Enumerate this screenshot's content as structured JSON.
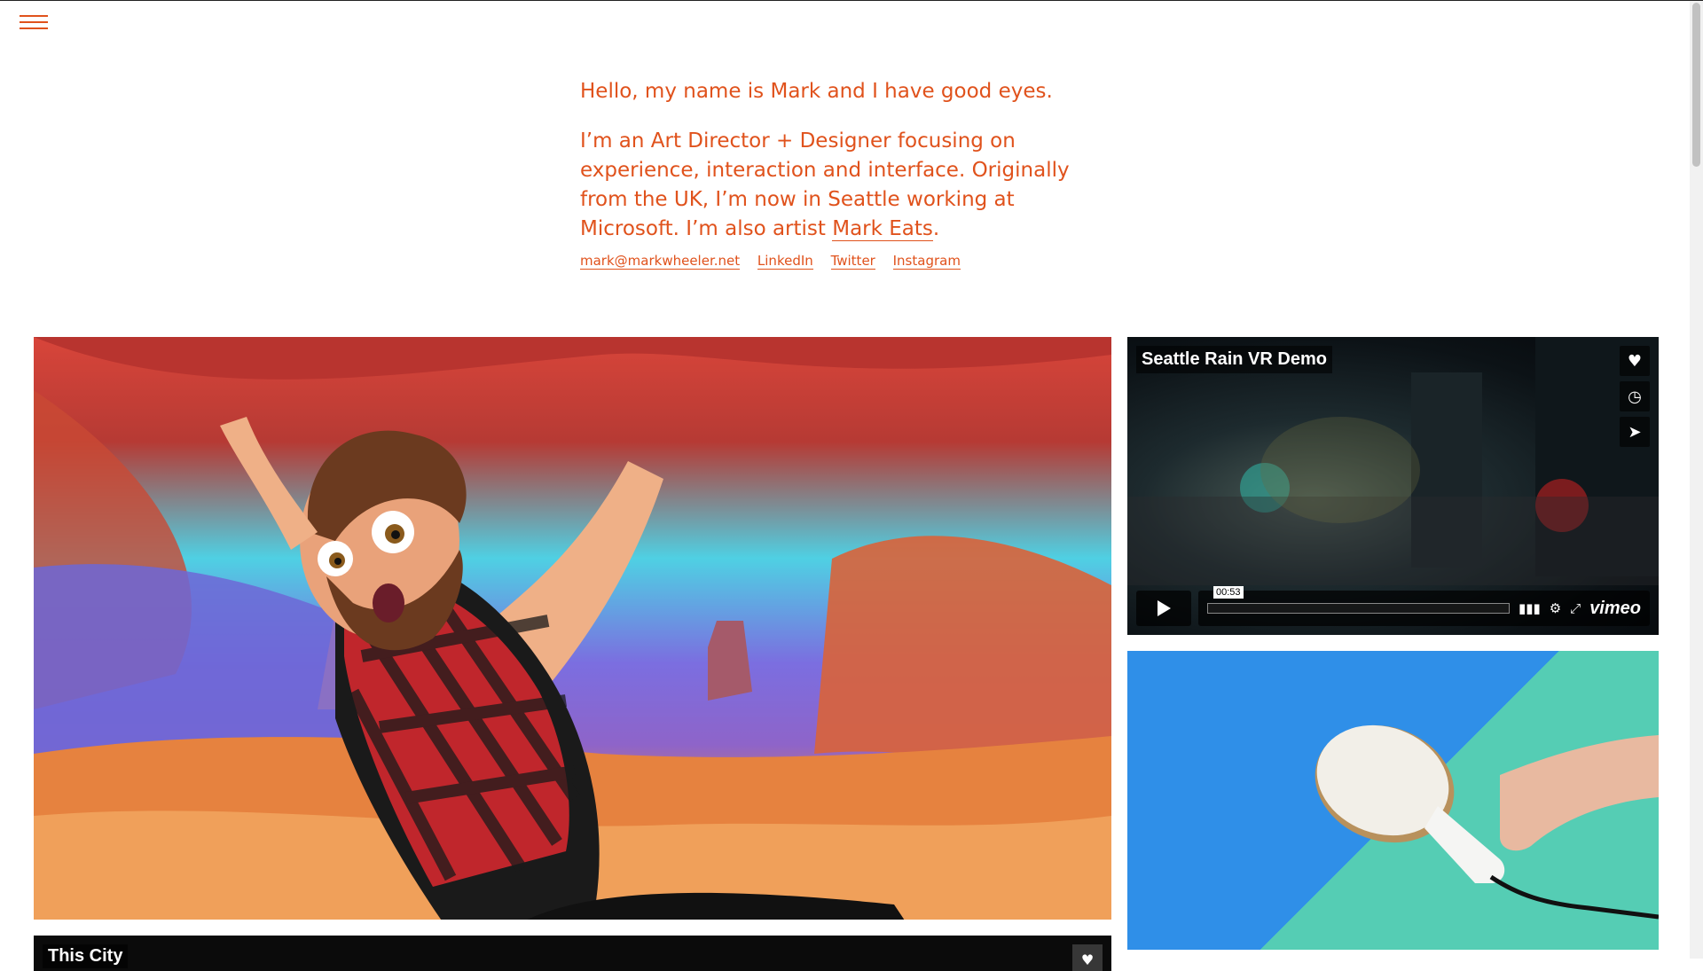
{
  "menu": {
    "icon": "hamburger-menu-icon"
  },
  "intro": {
    "greeting": "Hello, my name is Mark and I have good eyes.",
    "bio_text": "I’m an Art Director + Designer focusing on experience, interaction and interface. Originally from the UK, I’m now in Seattle working at Microsoft. I’m also artist ",
    "bio_link": "Mark Eats",
    "bio_end": "."
  },
  "links": {
    "email": "mark@markwheeler.net",
    "linkedin": "LinkedIn",
    "twitter": "Twitter",
    "instagram": "Instagram"
  },
  "video_1": {
    "title": "Seattle Rain VR Demo",
    "time": "00:53",
    "progress": 0.0,
    "brand": "vimeo",
    "icons": [
      "heart-icon",
      "clock-icon",
      "send-icon",
      "play-icon",
      "volume-icon",
      "settings-icon",
      "fullscreen-icon"
    ]
  },
  "video_2": {
    "title": "This City",
    "icons": [
      "heart-icon"
    ]
  },
  "colors": {
    "accent": "#e0521c"
  }
}
